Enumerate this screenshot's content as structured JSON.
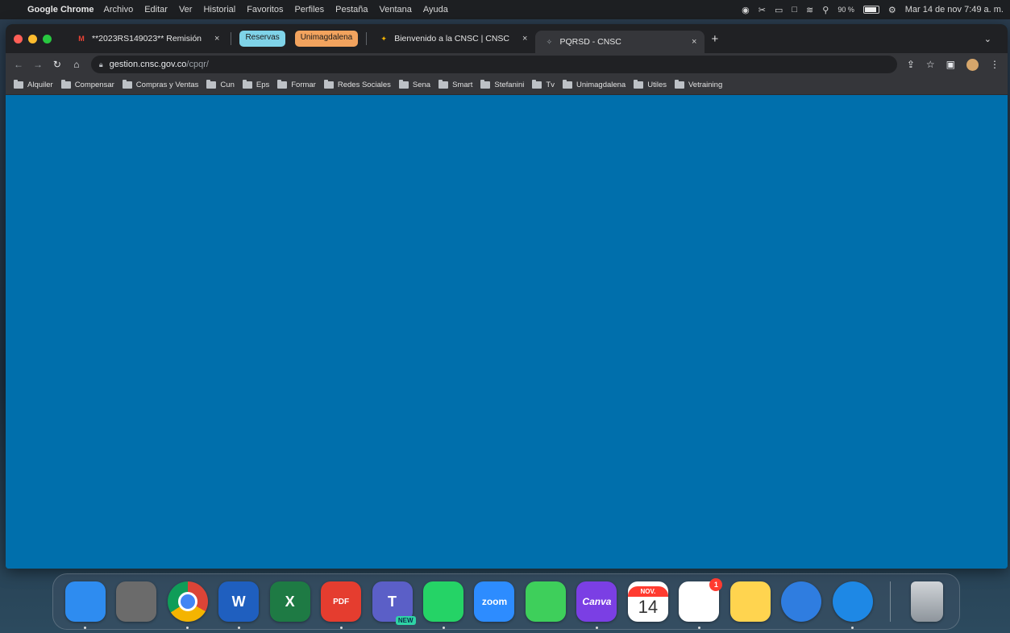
{
  "menubar": {
    "app_name": "Google Chrome",
    "menus": [
      "Archivo",
      "Editar",
      "Ver",
      "Historial",
      "Favoritos",
      "Perfiles",
      "Pestaña",
      "Ventana",
      "Ayuda"
    ],
    "battery_percent": "90 %",
    "battery_level": 0.9,
    "datetime": "Mar 14 de nov  7:49 a. m."
  },
  "tabs": [
    {
      "title": "**2023RS149023** Remisión",
      "favicon": "gmail-icon",
      "close": "×"
    },
    {
      "group_label": "Reservas",
      "color": "#7fd3e8"
    },
    {
      "group_label": "Unimagdalena",
      "color": "#f2a35e"
    },
    {
      "title": "Bienvenido a la CNSC | CNSC",
      "favicon": "cnsc-icon",
      "close": "×"
    },
    {
      "title": "PQRSD - CNSC",
      "favicon": "cnsc-icon",
      "close": "×",
      "active": true
    }
  ],
  "toolbar": {
    "url_host": "gestion.cnsc.gov.co",
    "url_path": "/cpqr/"
  },
  "bookmarks": [
    "Alquiler",
    "Compensar",
    "Compras y Ventas",
    "Cun",
    "Eps",
    "Formar",
    "Redes Sociales",
    "Sena",
    "Smart",
    "Stefanini",
    "Tv",
    "Unimagdalena",
    "Utiles",
    "Vetraining"
  ],
  "colors": {
    "page_background": "#006fac",
    "chrome_dark": "#202124",
    "chrome_toolbar": "#35363a"
  },
  "dock": {
    "apps": [
      {
        "name": "finder-icon",
        "label": "",
        "color": "#2e8cf0",
        "running": true
      },
      {
        "name": "launchpad-icon",
        "label": "",
        "color": "#6b6b6b",
        "running": false
      },
      {
        "name": "chrome-icon",
        "label": "",
        "color": "#ffffff",
        "running": true
      },
      {
        "name": "word-icon",
        "label": "W",
        "color": "#1f5fbf",
        "running": true
      },
      {
        "name": "excel-icon",
        "label": "X",
        "color": "#1e7a44",
        "running": false
      },
      {
        "name": "pdf-reader-icon",
        "label": "PDF",
        "color": "#e53d2f",
        "running": true
      },
      {
        "name": "teams-icon",
        "label": "T",
        "badge": "NEW",
        "color": "#5b5fc7",
        "running": false
      },
      {
        "name": "whatsapp-icon",
        "label": "",
        "color": "#25d366",
        "running": true
      },
      {
        "name": "zoom-icon",
        "label": "zoom",
        "color": "#2d8cff",
        "running": false
      },
      {
        "name": "facetime-icon",
        "label": "",
        "color": "#3ecf5b",
        "running": false
      },
      {
        "name": "canva-icon",
        "label": "Canva",
        "color": "#7b3fe4",
        "running": true
      },
      {
        "name": "calendar-icon",
        "month": "NOV.",
        "day": "14",
        "color": "#ffffff",
        "running": false
      },
      {
        "name": "reminders-icon",
        "badge": "1",
        "color": "#ffffff",
        "running": true
      },
      {
        "name": "notes-icon",
        "label": "",
        "color": "#ffd44f",
        "running": false
      },
      {
        "name": "proxyman-icon",
        "label": "",
        "color": "#2f7de0",
        "running": false
      },
      {
        "name": "safari-icon",
        "label": "",
        "color": "#1e88e5",
        "running": true
      },
      {
        "name": "trash-icon",
        "label": "",
        "color": "#9aa0a6",
        "running": false
      }
    ]
  }
}
